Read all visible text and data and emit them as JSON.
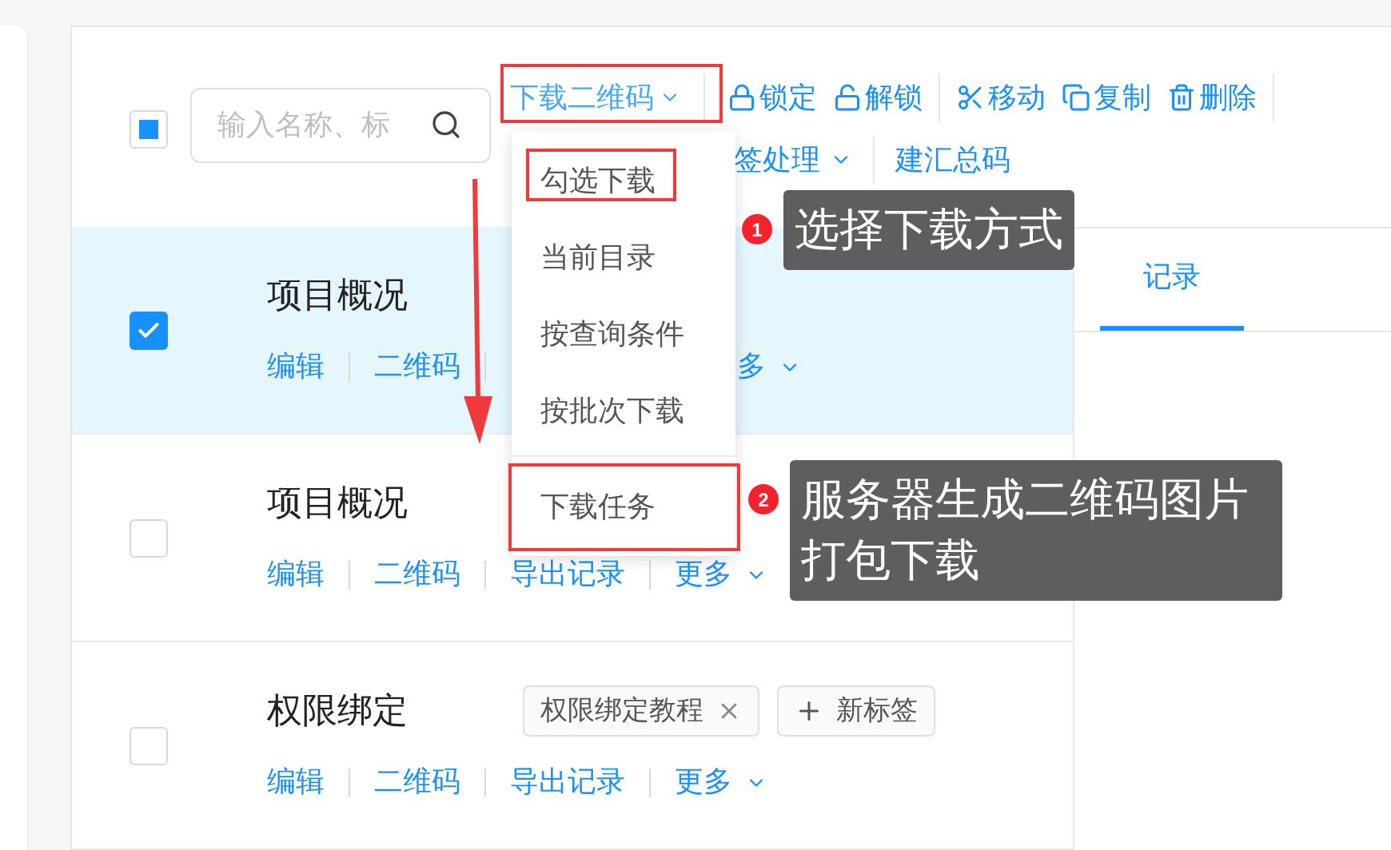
{
  "toolbar": {
    "select_all": {
      "indeterminate": true
    },
    "search": {
      "placeholder": "输入名称、标"
    },
    "download_menu": {
      "label": "下载二维码",
      "expanded": true,
      "items": [
        {
          "label": "勾选下载",
          "divider_before": false
        },
        {
          "label": "当前目录",
          "divider_before": false
        },
        {
          "label": "按查询条件",
          "divider_before": false
        },
        {
          "label": "按批次下载",
          "divider_before": false
        },
        {
          "label": "下载任务",
          "divider_before": true
        }
      ]
    },
    "actions": [
      {
        "label": "锁定",
        "kind": "lock",
        "divider_after": false
      },
      {
        "label": "解锁",
        "kind": "unlock",
        "divider_after": true
      },
      {
        "label": "移动",
        "kind": "move",
        "divider_after": false
      },
      {
        "label": "复制",
        "kind": "copy",
        "divider_after": false
      },
      {
        "label": "删除",
        "kind": "delete",
        "divider_after": true
      }
    ],
    "second_row": [
      {
        "label": "签处理",
        "kind": "dropdown"
      },
      {
        "label": "建汇总码",
        "kind": "link"
      }
    ]
  },
  "rows": [
    {
      "title": "项目概况",
      "checked": true,
      "selected": true,
      "tags": [],
      "actions": [
        "编辑",
        "二维码"
      ],
      "more": "多"
    },
    {
      "title": "项目概况",
      "checked": false,
      "selected": false,
      "tags": [],
      "actions": [
        "编辑",
        "二维码",
        "导出记录"
      ],
      "more": "更多"
    },
    {
      "title": "权限绑定",
      "checked": false,
      "selected": false,
      "tags": [
        {
          "label": "权限绑定教程",
          "kind": "tag"
        },
        {
          "label": "新标签",
          "kind": "add"
        }
      ],
      "actions": [
        "编辑",
        "二维码",
        "导出记录"
      ],
      "more": "更多"
    }
  ],
  "detail_tabs": [
    {
      "label": "记录",
      "selected": true
    }
  ],
  "annotations": [
    {
      "number": "1",
      "text": "选择下载方式"
    },
    {
      "number": "2",
      "text": "服务器生成二维码图片打包下载"
    }
  ]
}
